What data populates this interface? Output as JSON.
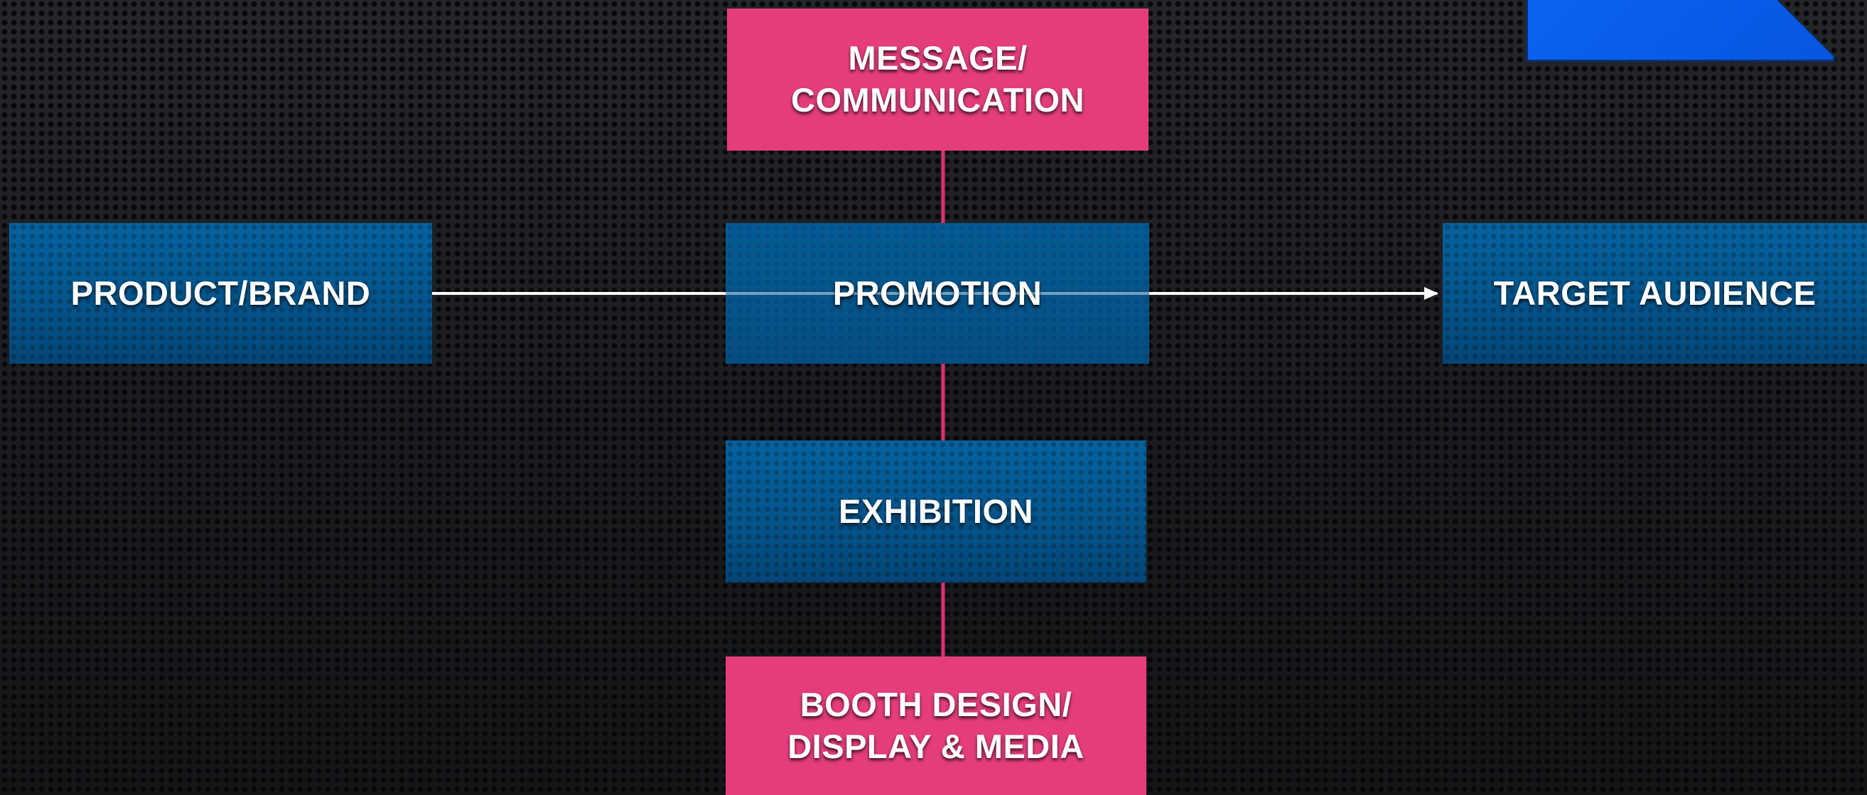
{
  "diagram": {
    "nodes": {
      "message": {
        "label": "MESSAGE/\nCOMMUNICATION"
      },
      "product": {
        "label": "PRODUCT/BRAND"
      },
      "promotion": {
        "label": "PROMOTION"
      },
      "target": {
        "label": "TARGET AUDIENCE"
      },
      "exhibition": {
        "label": "EXHIBITION"
      },
      "booth": {
        "label": "BOOTH DESIGN/\nDISPLAY & MEDIA"
      }
    },
    "edges": [
      {
        "from": "product",
        "to": "target",
        "style": "arrow"
      },
      {
        "from": "message",
        "to": "promotion",
        "style": "line"
      },
      {
        "from": "promotion",
        "to": "exhibition",
        "style": "line"
      },
      {
        "from": "exhibition",
        "to": "booth",
        "style": "line"
      }
    ]
  },
  "colors": {
    "box_blue": "#05578f",
    "box_pink": "#e53d7c",
    "connector_pink": "#d8326f",
    "arrow_white": "#ffffff",
    "corner_tab_blue": "#0a5ff0"
  }
}
